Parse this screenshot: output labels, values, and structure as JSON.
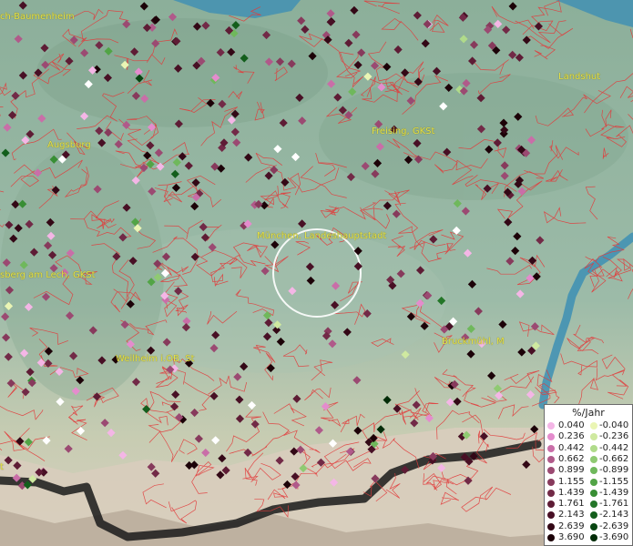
{
  "map": {
    "place_labels": [
      "ch-Baumenheim",
      "Landshut",
      "Augsburg",
      "Freising, GKSt",
      "München, Landeshauptstadt",
      "sberg am Lech, GKSt",
      "Bruckmühl, M",
      "Weilheim i.OB, St",
      "t"
    ],
    "colors": {
      "boundary": "#e23b3b",
      "lake": "#3d8fb4",
      "label": "#e6e24a",
      "mountain_line": "#1a1a1a",
      "highlight_circle": "#ffffff"
    }
  },
  "legend": {
    "title": "%/Jahr",
    "positive": [
      {
        "label": "0.040",
        "color": "#f4b6e6"
      },
      {
        "label": "0.236",
        "color": "#e48ccd"
      },
      {
        "label": "0.442",
        "color": "#c96ea8"
      },
      {
        "label": "0.662",
        "color": "#b05a8a"
      },
      {
        "label": "0.899",
        "color": "#9b4a72"
      },
      {
        "label": "1.155",
        "color": "#873a5c"
      },
      {
        "label": "1.439",
        "color": "#722a47"
      },
      {
        "label": "1.761",
        "color": "#5e1c35"
      },
      {
        "label": "2.143",
        "color": "#481025"
      },
      {
        "label": "2.639",
        "color": "#330816"
      },
      {
        "label": "3.690",
        "color": "#1c0208"
      }
    ],
    "negative": [
      {
        "label": "-0.040",
        "color": "#eaf5b4"
      },
      {
        "label": "-0.236",
        "color": "#cfe9a0"
      },
      {
        "label": "-0.442",
        "color": "#b0db8a"
      },
      {
        "label": "-0.662",
        "color": "#8fca72"
      },
      {
        "label": "-0.899",
        "color": "#6fb85c"
      },
      {
        "label": "-1.155",
        "color": "#52a446"
      },
      {
        "label": "-1.439",
        "color": "#388e34"
      },
      {
        "label": "-1.761",
        "color": "#237628"
      },
      {
        "label": "-2.143",
        "color": "#135e1c"
      },
      {
        "label": "-2.639",
        "color": "#084612"
      },
      {
        "label": "-3.690",
        "color": "#022c08"
      }
    ]
  }
}
